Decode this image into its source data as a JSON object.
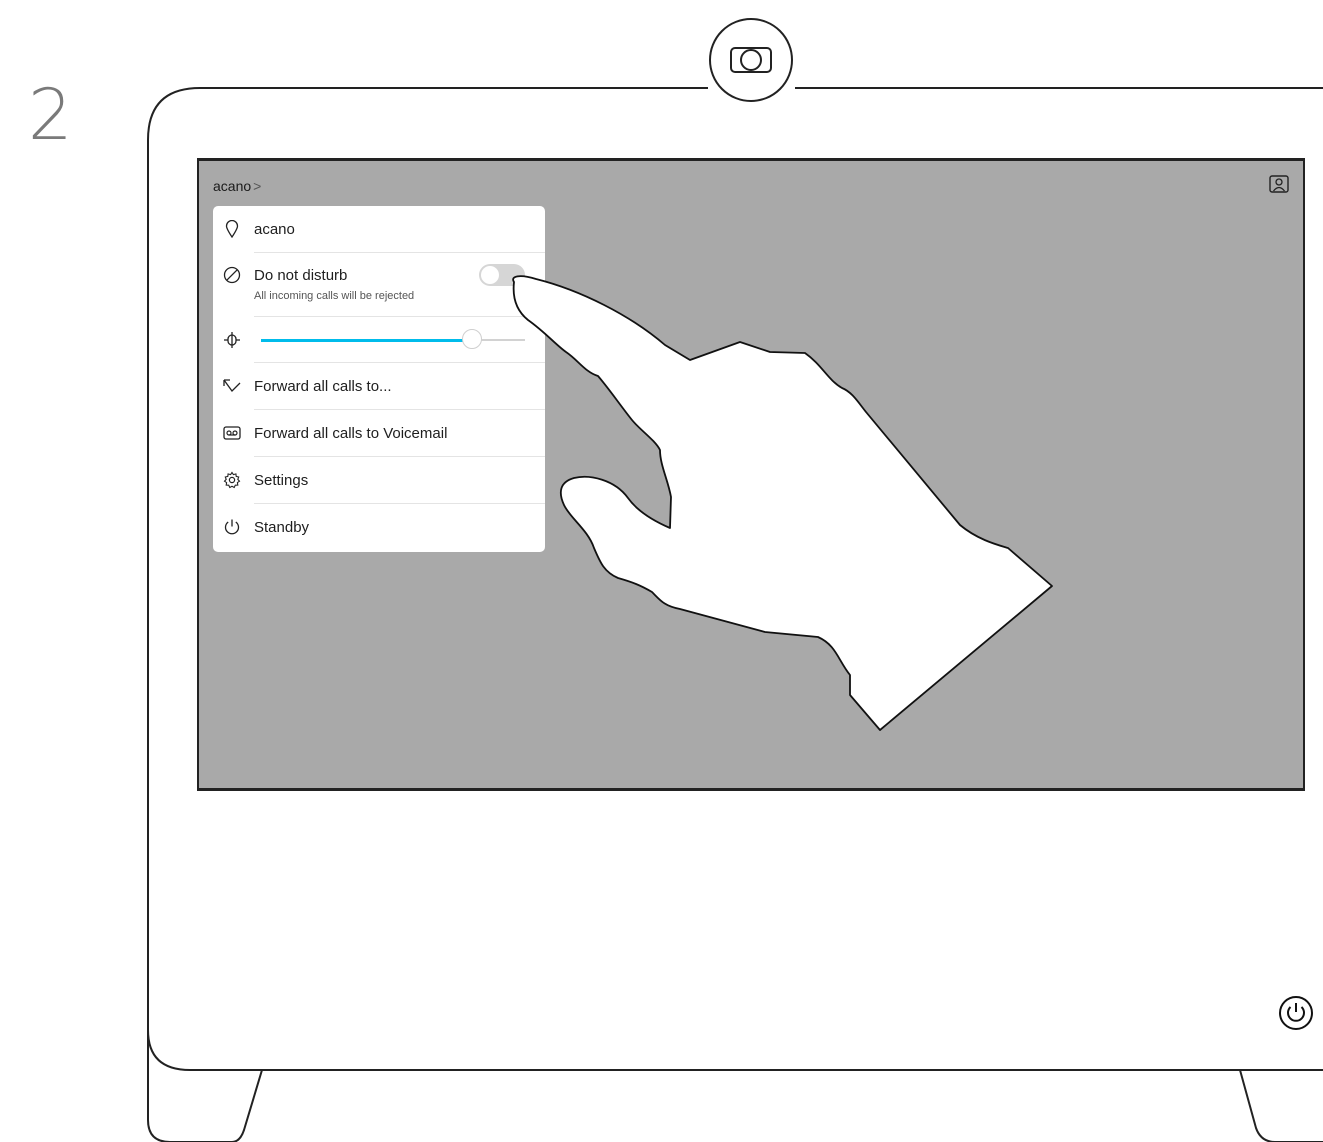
{
  "step": {
    "number": "2"
  },
  "screen": {
    "breadcrumb": {
      "label": "acano",
      "chevron": ">"
    },
    "selfview_icon": "selfview-icon"
  },
  "menu": {
    "location": {
      "icon": "location-pin-icon",
      "label": "acano"
    },
    "do_not_disturb": {
      "icon": "block-icon",
      "label": "Do not disturb",
      "sublabel": "All incoming calls will be rejected",
      "enabled": false
    },
    "brightness": {
      "icon": "brightness-icon",
      "level": 0.8
    },
    "forward": {
      "icon": "forward-arrow-icon",
      "label": "Forward all calls to..."
    },
    "voicemail": {
      "icon": "voicemail-icon",
      "label": "Forward all calls to Voicemail"
    },
    "settings": {
      "icon": "gear-icon",
      "label": "Settings"
    },
    "standby": {
      "icon": "standby-icon",
      "label": "Standby"
    }
  },
  "colors": {
    "screen_bg": "#a9a9a9",
    "slider_accent": "#00bceb",
    "panel_bg": "#ffffff"
  }
}
